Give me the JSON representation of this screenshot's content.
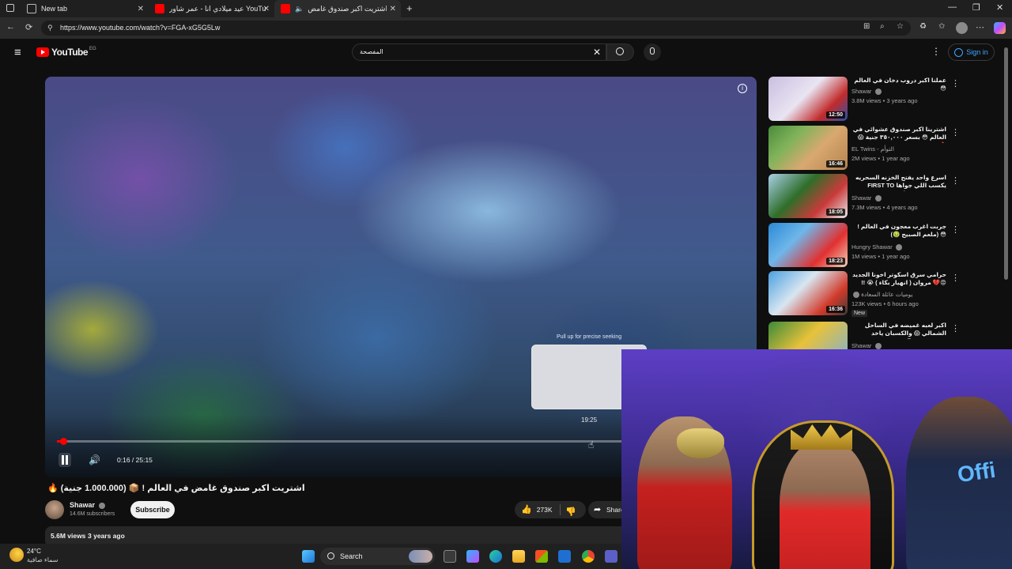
{
  "browser": {
    "tabs": [
      {
        "title": "New tab"
      },
      {
        "title": "عيد ميلادي انا - عمر شاور YouTube"
      },
      {
        "title": "اشتريت اكبر صندوق غامض"
      }
    ],
    "url": "https://www.youtube.com/watch?v=FGA-xG5G5Lw"
  },
  "youtube": {
    "logo_text": "YouTube",
    "region": "EG",
    "search_value": "المفصحة",
    "signin_label": "Sign in"
  },
  "player": {
    "current_time": "0:16",
    "duration": "25:15",
    "time_display": "0:16 / 25:15",
    "progress_fraction": 0.0106,
    "seek_hint": "Pull up for precise seeking",
    "seek_time": "19:25"
  },
  "video": {
    "title": "اشتريت اكبر صندوق غامض في العالم ! 📦 (1.000.000 جنية) 🔥",
    "channel": "Shawar",
    "subscribers": "14.6M subscribers",
    "subscribe_label": "Subscribe",
    "likes": "273K",
    "share_label": "Share",
    "views": "5.6M views",
    "age": "3 years ago"
  },
  "recommendations": [
    {
      "title": "عملنا اكبر دروب دخان في العالم 😳",
      "channel": "Shawar",
      "views": "3.8M views",
      "age": "3 years ago",
      "duration": "12:50",
      "verified": true,
      "color_a": "#c9bfe0",
      "color_b": "#c22b2b"
    },
    {
      "title": "اشترينا اكبر صندوق عشوائي في العالم 😳 بسعر ٣٥٠,٠٠٠ جنية 😱🔥",
      "channel": "EL Twins - التوأم",
      "views": "2M views",
      "age": "1 year ago",
      "duration": "16:46",
      "verified": false,
      "color_a": "#d9a870",
      "color_b": "#4a8a3a"
    },
    {
      "title": "اسرع واحد يفتح الخزنه السحريه يكسب اللي جواها FIRST TO BREAK OPEN |",
      "channel": "Shawar",
      "views": "7.3M views",
      "age": "4 years ago",
      "duration": "18:05",
      "verified": true,
      "color_a": "#2f6e2a",
      "color_b": "#a9d0e6"
    },
    {
      "title": "جربت اغرب معجون في العالم !😳 (ملعم الصبيح 🤢)",
      "channel": "Hungry Shawar",
      "views": "1M views",
      "age": "1 year ago",
      "duration": "18:23",
      "verified": true,
      "color_a": "#2b8ad6",
      "color_b": "#e23030"
    },
    {
      "title": "حرامي سرق اسكوتر اخونا الجديد 😡💔 مروان ( انهيار بكاء ) 😭 !!",
      "channel": "يوميات عائلة السعادة",
      "views": "123K views",
      "age": "6 hours ago",
      "duration": "16:36",
      "verified": true,
      "new_label": "New",
      "color_a": "#4aa0e0",
      "color_b": "#d23a2a"
    },
    {
      "title": "اكبر لعبه غميضه في الساحل الشمالي 😱 والكسبان ياخد 20.000 جنيه 😳",
      "channel": "Shawar",
      "views": "",
      "age": "",
      "duration": "",
      "verified": true,
      "color_a": "#3d8a3a",
      "color_b": "#e8c23a"
    }
  ],
  "taskbar": {
    "temperature": "24°C",
    "weather": "سماء صافية",
    "search_label": "Search"
  },
  "colors": {
    "accent": "#ff0000",
    "link": "#3ea6ff",
    "background": "#0f0f0f"
  }
}
